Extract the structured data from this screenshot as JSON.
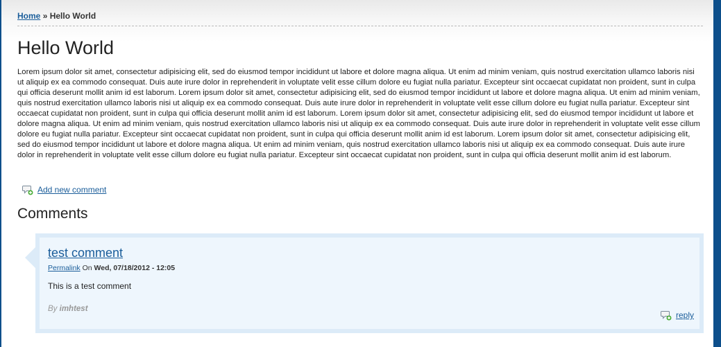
{
  "breadcrumb": {
    "home_label": "Home",
    "separator": "»",
    "current": "Hello World"
  },
  "page": {
    "title": "Hello World",
    "body": "Lorem ipsum dolor sit amet, consectetur adipisicing elit, sed do eiusmod tempor incididunt ut labore et dolore magna aliqua. Ut enim ad minim veniam, quis nostrud exercitation ullamco laboris nisi ut aliquip ex ea commodo consequat. Duis aute irure dolor in reprehenderit in voluptate velit esse cillum dolore eu fugiat nulla pariatur. Excepteur sint occaecat cupidatat non proident, sunt in culpa qui officia deserunt mollit anim id est laborum. Lorem ipsum dolor sit amet, consectetur adipisicing elit, sed do eiusmod tempor incididunt ut labore et dolore magna aliqua. Ut enim ad minim veniam, quis nostrud exercitation ullamco laboris nisi ut aliquip ex ea commodo consequat. Duis aute irure dolor in reprehenderit in voluptate velit esse cillum dolore eu fugiat nulla pariatur. Excepteur sint occaecat cupidatat non proident, sunt in culpa qui officia deserunt mollit anim id est laborum. Lorem ipsum dolor sit amet, consectetur adipisicing elit, sed do eiusmod tempor incididunt ut labore et dolore magna aliqua. Ut enim ad minim veniam, quis nostrud exercitation ullamco laboris nisi ut aliquip ex ea commodo consequat. Duis aute irure dolor in reprehenderit in voluptate velit esse cillum dolore eu fugiat nulla pariatur. Excepteur sint occaecat cupidatat non proident, sunt in culpa qui officia deserunt mollit anim id est laborum. Lorem ipsum dolor sit amet, consectetur adipisicing elit, sed do eiusmod tempor incididunt ut labore et dolore magna aliqua. Ut enim ad minim veniam, quis nostrud exercitation ullamco laboris nisi ut aliquip ex ea commodo consequat. Duis aute irure dolor in reprehenderit in voluptate velit esse cillum dolore eu fugiat nulla pariatur. Excepteur sint occaecat cupidatat non proident, sunt in culpa qui officia deserunt mollit anim id est laborum."
  },
  "add_comment": {
    "icon": "comment-add-icon",
    "label": "Add new comment"
  },
  "comments": {
    "heading": "Comments",
    "items": [
      {
        "title": "test comment",
        "permalink_label": "Permalink",
        "on_label": "On",
        "date": "Wed, 07/18/2012 - 12:05",
        "body": "This is a test comment",
        "by_label": "By",
        "author": "imhtest",
        "reply_icon": "comment-reply-icon",
        "reply_label": "reply"
      }
    ]
  },
  "colors": {
    "frame": "#0d4f8b",
    "link": "#1a5d9a",
    "comment_background": "#eef6fd",
    "comment_border": "#dcebf8"
  }
}
